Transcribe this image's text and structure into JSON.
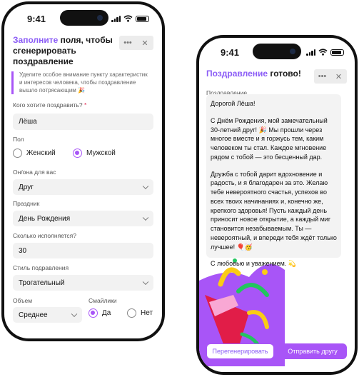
{
  "status_bar": {
    "time": "9:41"
  },
  "form_screen": {
    "title_accent": "Заполните",
    "title_rest": " поля, чтобы сгенерировать поздравление",
    "hint": "Уделите особое внимание пункту характеристик и интересов человека, чтобы поздравление вышло потрясающим 🎉",
    "recipient": {
      "label": "Кого хотите поздравить?",
      "required_mark": "*",
      "value": "Лёша"
    },
    "gender": {
      "label": "Пол",
      "options": [
        "Женский",
        "Мужской"
      ],
      "selected": "Мужской"
    },
    "relation": {
      "label": "Он/она для вас",
      "value": "Друг"
    },
    "holiday": {
      "label": "Праздник",
      "value": "День Рождения"
    },
    "age": {
      "label": "Сколько исполняется?",
      "value": "30"
    },
    "style": {
      "label": "Стиль подравления",
      "value": "Трогательный"
    },
    "length": {
      "label": "Объем",
      "value": "Среднее"
    },
    "emoji": {
      "label": "Смайлики",
      "options": [
        "Да",
        "Нет"
      ],
      "selected": "Да"
    }
  },
  "result_screen": {
    "title_accent": "Поздравление",
    "title_rest": " готово!",
    "section_label": "Поздравление",
    "paragraphs": [
      "Дорогой Лёша!",
      "С Днём Рождения, мой замечательный 30-летний друг! 🎉 Мы прошли через многое вместе и я горжусь тем, каким человеком ты стал. Каждое мгновение рядом с тобой — это бесценный дар.",
      "Дружба с тобой дарит вдохновение и радость, и я благодарен за это. Желаю тебе невероятного счастья, успехов во всех твоих начинаниях и, конечно же, крепкого здоровья! Пусть каждый день приносит новое открытие, а каждый миг становится незабываемым. Ты — невероятный, и впереди тебя ждёт только лучшее! 🎈🥳",
      "С любовью и уважением. 💫"
    ],
    "regenerate_label": "Перегенерировать",
    "send_label": "Отправить другу"
  },
  "window_controls": {
    "more": "•••",
    "close": "✕"
  },
  "colors": {
    "accent": "#8b5cf6",
    "button": "#a855f7",
    "required": "#e11d48"
  },
  "icons": [
    "signal-icon",
    "wifi-icon",
    "battery-icon",
    "more-icon",
    "close-icon",
    "chevron-down-icon",
    "party-popper-illustration"
  ]
}
